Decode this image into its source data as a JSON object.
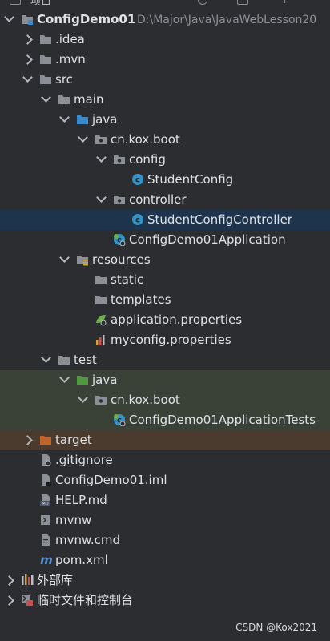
{
  "header": {
    "title_fragment": "项目"
  },
  "tree": [
    {
      "label": "ConfigDemo01",
      "path": "D:\\Major\\Java\\JavaWebLesson20",
      "icon": "module-folder-icon",
      "depth": 0,
      "arrow": "down",
      "bold": true
    },
    {
      "label": ".idea",
      "icon": "folder-icon",
      "depth": 1,
      "arrow": "right"
    },
    {
      "label": ".mvn",
      "icon": "folder-icon",
      "depth": 1,
      "arrow": "right"
    },
    {
      "label": "src",
      "icon": "folder-icon",
      "depth": 1,
      "arrow": "down"
    },
    {
      "label": "main",
      "icon": "folder-icon",
      "depth": 2,
      "arrow": "down"
    },
    {
      "label": "java",
      "icon": "source-folder-icon",
      "depth": 3,
      "arrow": "down"
    },
    {
      "label": "cn.kox.boot",
      "icon": "package-icon",
      "depth": 4,
      "arrow": "down"
    },
    {
      "label": "config",
      "icon": "package-icon",
      "depth": 5,
      "arrow": "down"
    },
    {
      "label": "StudentConfig",
      "icon": "class-icon",
      "depth": 6,
      "arrow": "none"
    },
    {
      "label": "controller",
      "icon": "package-icon",
      "depth": 5,
      "arrow": "down"
    },
    {
      "label": "StudentConfigController",
      "icon": "class-icon",
      "depth": 6,
      "arrow": "none",
      "state": "selected"
    },
    {
      "label": "ConfigDemo01Application",
      "icon": "spring-class-icon",
      "depth": 5,
      "arrow": "none"
    },
    {
      "label": "resources",
      "icon": "resources-folder-icon",
      "depth": 3,
      "arrow": "down"
    },
    {
      "label": "static",
      "icon": "folder-icon",
      "depth": 4,
      "arrow": "none"
    },
    {
      "label": "templates",
      "icon": "folder-icon",
      "depth": 4,
      "arrow": "none"
    },
    {
      "label": "application.properties",
      "icon": "spring-properties-icon",
      "depth": 4,
      "arrow": "none"
    },
    {
      "label": "myconfig.properties",
      "icon": "properties-icon",
      "depth": 4,
      "arrow": "none"
    },
    {
      "label": "test",
      "icon": "folder-icon",
      "depth": 2,
      "arrow": "down"
    },
    {
      "label": "java",
      "icon": "test-source-folder-icon",
      "depth": 3,
      "arrow": "down",
      "state": "test"
    },
    {
      "label": "cn.kox.boot",
      "icon": "package-icon",
      "depth": 4,
      "arrow": "down",
      "state": "test"
    },
    {
      "label": "ConfigDemo01ApplicationTests",
      "icon": "spring-class-icon",
      "depth": 5,
      "arrow": "none",
      "state": "test"
    },
    {
      "label": "target",
      "icon": "excluded-folder-icon",
      "depth": 1,
      "arrow": "right",
      "state": "excluded"
    },
    {
      "label": ".gitignore",
      "icon": "gitignore-file-icon",
      "depth": 1,
      "arrow": "none"
    },
    {
      "label": "ConfigDemo01.iml",
      "icon": "iml-file-icon",
      "depth": 1,
      "arrow": "none"
    },
    {
      "label": "HELP.md",
      "icon": "markdown-file-icon",
      "depth": 1,
      "arrow": "none"
    },
    {
      "label": "mvnw",
      "icon": "shell-file-icon",
      "depth": 1,
      "arrow": "none"
    },
    {
      "label": "mvnw.cmd",
      "icon": "text-file-icon",
      "depth": 1,
      "arrow": "none"
    },
    {
      "label": "pom.xml",
      "icon": "maven-icon",
      "depth": 1,
      "arrow": "none"
    },
    {
      "label": "外部库",
      "icon": "external-libraries-icon",
      "depth": 0,
      "arrow": "right"
    },
    {
      "label": "临时文件和控制台",
      "icon": "scratches-icon",
      "depth": 0,
      "arrow": "right"
    }
  ],
  "colors": {
    "background": "#2b2d30",
    "selected": "#1e344d",
    "test_highlight": "#3a4237",
    "excluded_highlight": "#4a3b2e",
    "folder": "#8c9096",
    "source_folder": "#3d88c7",
    "test_folder": "#4e9a3c",
    "excluded_folder": "#c0652e",
    "class_icon": "#3592c4"
  },
  "watermark": "CSDN @Kox2021"
}
